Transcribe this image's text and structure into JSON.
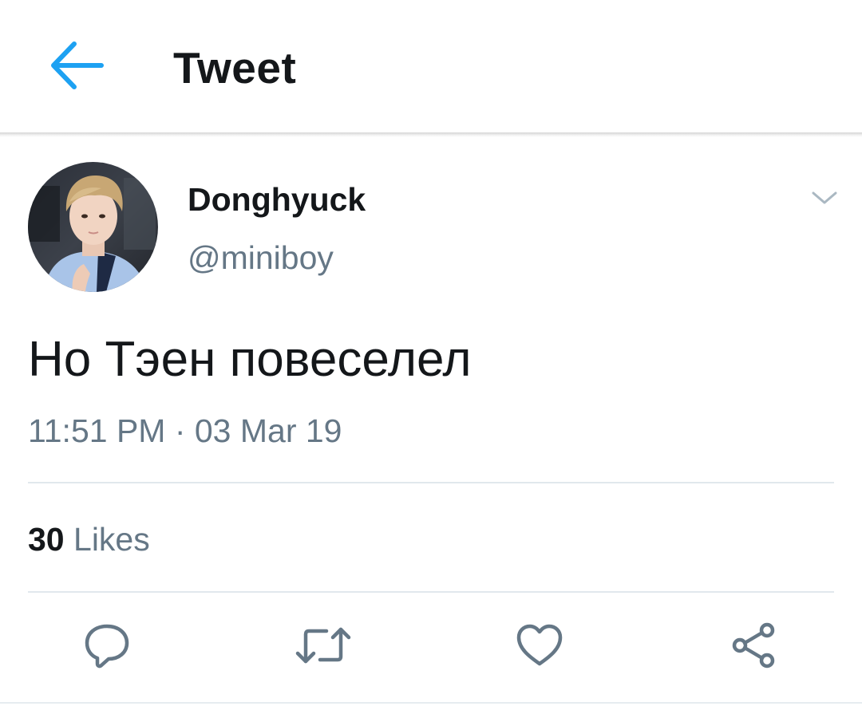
{
  "appbar": {
    "title": "Tweet",
    "back_icon": "arrow-left-icon",
    "accent_color": "#1da1f2"
  },
  "tweet": {
    "author": {
      "name": "Donghyuck",
      "handle": "@miniboy",
      "avatar": "avatar-photo"
    },
    "menu_icon": "chevron-down-icon",
    "text": "Но Тэен повеселел",
    "meta": "11:51 PM · 03 Mar 19",
    "likes": {
      "count": "30",
      "label": "Likes"
    },
    "actions": [
      {
        "icon": "reply-icon"
      },
      {
        "icon": "retweet-icon"
      },
      {
        "icon": "heart-icon"
      },
      {
        "icon": "share-icon"
      }
    ]
  },
  "colors": {
    "text_primary": "#14171a",
    "text_secondary": "#657786",
    "divider": "#e1e8ed",
    "icon_gray": "#657786"
  }
}
